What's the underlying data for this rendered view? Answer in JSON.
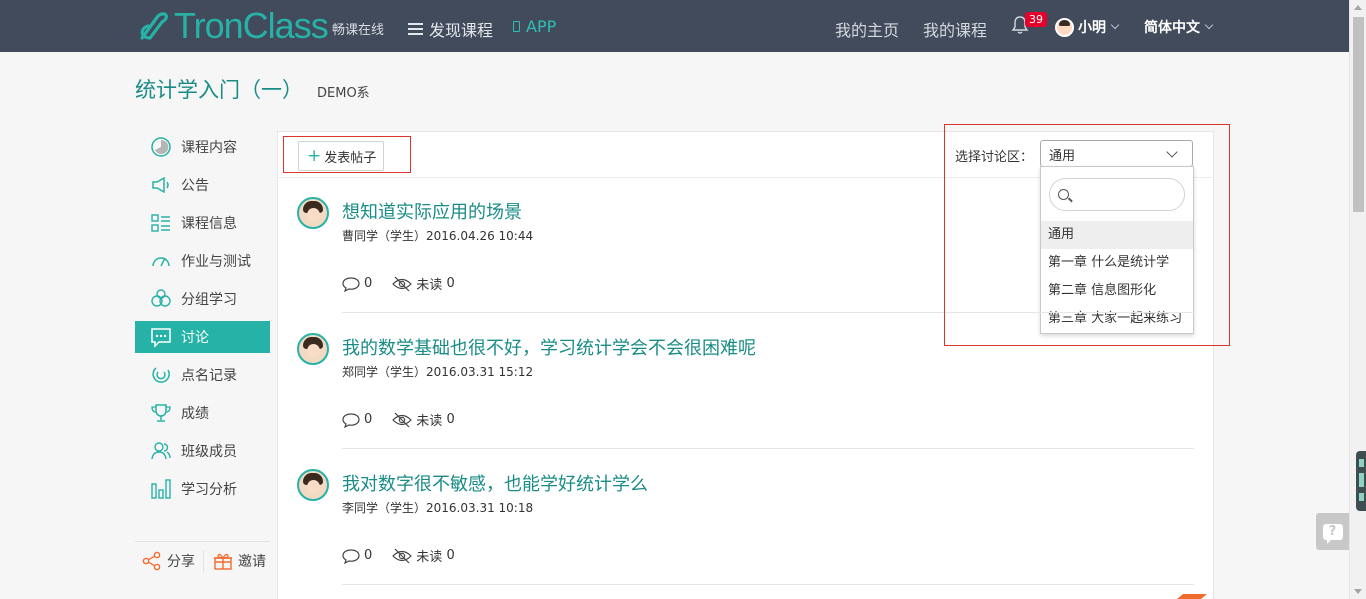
{
  "nav": {
    "logo": "TronClass",
    "tagline": "畅课在线",
    "discover": "发现课程",
    "app": "APP",
    "home": "我的主页",
    "my_courses": "我的课程",
    "notification_count": "39",
    "user_name": "小明",
    "language": "简体中文"
  },
  "course": {
    "title": "统计学入门（一）",
    "department": "DEMO系"
  },
  "sidebar": {
    "items": [
      {
        "label": "课程内容",
        "icon": "course-content-icon",
        "active": false
      },
      {
        "label": "公告",
        "icon": "megaphone-icon",
        "active": false
      },
      {
        "label": "课程信息",
        "icon": "list-icon",
        "active": false
      },
      {
        "label": "作业与测试",
        "icon": "gauge-icon",
        "active": false
      },
      {
        "label": "分组学习",
        "icon": "group-icon",
        "active": false
      },
      {
        "label": "讨论",
        "icon": "chat-icon",
        "active": true
      },
      {
        "label": "点名记录",
        "icon": "rollcall-icon",
        "active": false
      },
      {
        "label": "成绩",
        "icon": "trophy-icon",
        "active": false
      },
      {
        "label": "班级成员",
        "icon": "members-icon",
        "active": false
      },
      {
        "label": "学习分析",
        "icon": "bar-chart-icon",
        "active": false
      }
    ],
    "share": "分享",
    "invite": "邀请"
  },
  "toolbar": {
    "new_post": "发表帖子",
    "area_label": "选择讨论区：",
    "selected_area": "通用"
  },
  "dropdown": {
    "options": [
      "通用",
      "第一章 什么是统计学",
      "第二章 信息图形化",
      "第三章 大家一起来练习"
    ],
    "selected_index": 0
  },
  "posts": [
    {
      "title": "想知道实际应用的场景",
      "meta": "曹同学（学生）2016.04.26 10:44",
      "comments": "0",
      "unread_label": "未读",
      "unread": "0"
    },
    {
      "title": "我的数学基础也很不好，学习统计学会不会很困难呢",
      "meta": "郑同学（学生）2016.03.31 15:12",
      "comments": "0",
      "unread_label": "未读",
      "unread": "0"
    },
    {
      "title": "我对数字很不敏感，也能学好统计学么",
      "meta": "李同学（学生）2016.03.31 10:18",
      "comments": "0",
      "unread_label": "未读",
      "unread": "0"
    }
  ],
  "colors": {
    "accent": "#26b2a6",
    "nav_bg": "#414b5c",
    "highlight": "#d9352b"
  }
}
